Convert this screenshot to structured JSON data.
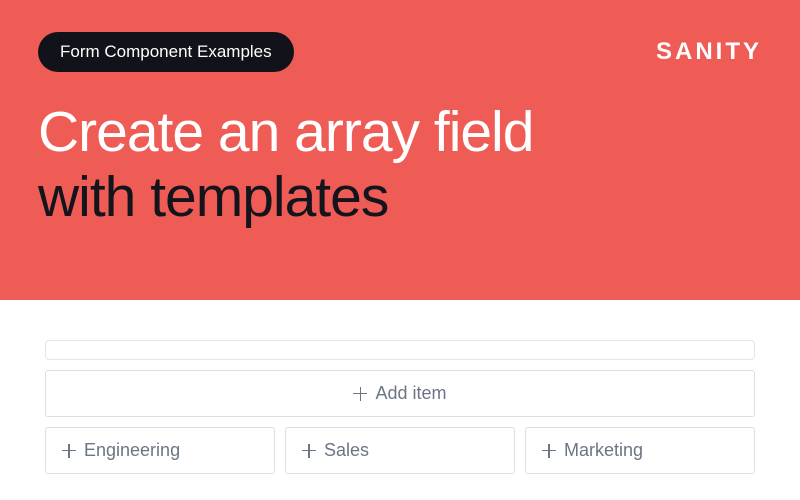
{
  "hero": {
    "badge": "Form Component Examples",
    "logo": "SANITY",
    "headline_line1": "Create an array field",
    "headline_line2": "with templates"
  },
  "form": {
    "add_item_label": "Add item",
    "templates": [
      {
        "label": "Engineering"
      },
      {
        "label": "Sales"
      },
      {
        "label": "Marketing"
      }
    ]
  }
}
